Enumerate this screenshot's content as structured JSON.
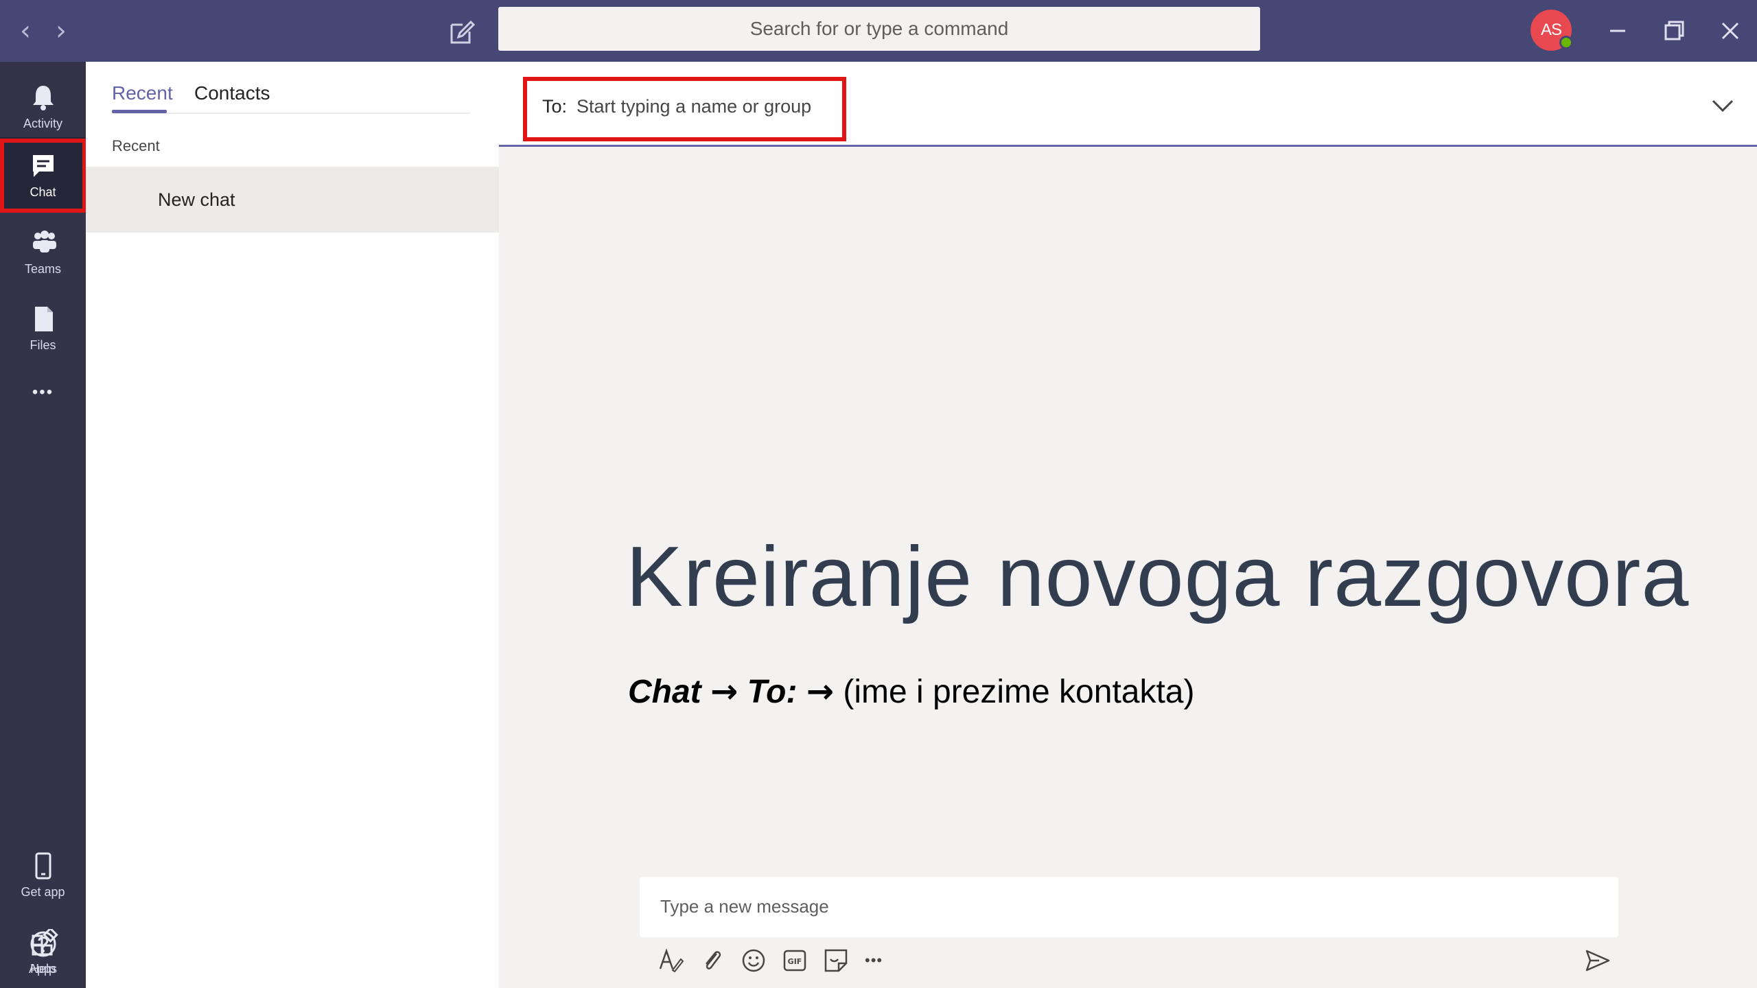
{
  "titlebar": {
    "search_placeholder": "Search for or type a command",
    "avatar_initials": "AS",
    "back_glyph": "‹",
    "forward_glyph": "›"
  },
  "rail": {
    "items": [
      {
        "label": "Activity",
        "icon": "bell-icon"
      },
      {
        "label": "Chat",
        "icon": "chat-icon"
      },
      {
        "label": "Teams",
        "icon": "teams-icon"
      },
      {
        "label": "Files",
        "icon": "file-icon"
      },
      {
        "label": "",
        "icon": "more-icon"
      },
      {
        "label": "Get app",
        "icon": "phone-icon"
      },
      {
        "label": "Apps",
        "icon": "apps-icon"
      },
      {
        "label": "Help",
        "icon": "help-icon"
      }
    ],
    "more_glyph": "•••"
  },
  "listpane": {
    "tabs": [
      "Recent",
      "Contacts"
    ],
    "section_label": "Recent",
    "items": [
      "New chat"
    ]
  },
  "chat": {
    "to_label": "To:",
    "to_placeholder": "Start typing a name or group",
    "compose_placeholder": "Type a new message",
    "more_glyph": "•••"
  },
  "slide": {
    "title": "Kreiranje novoga razgovora",
    "step1": "Chat",
    "step2": "To:",
    "step3": "(ime i prezime kontakta)",
    "arrow": "→"
  },
  "colors": {
    "titlebar": "#464775",
    "rail": "#33344a",
    "accent": "#6264a7",
    "highlight": "#e01515",
    "avatar": "#e8484f"
  }
}
